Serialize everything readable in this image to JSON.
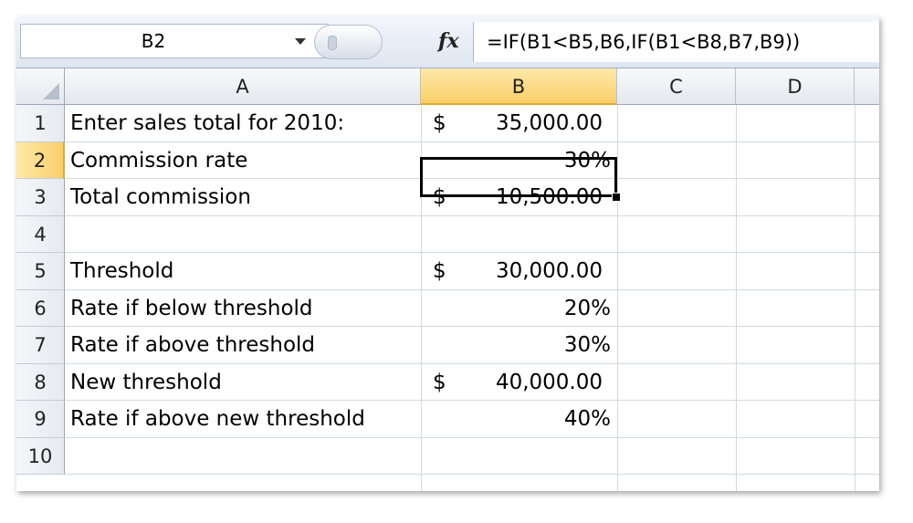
{
  "formula_bar": {
    "name_box": "B2",
    "fx_label": "fx",
    "formula": "=IF(B1<B5,B6,IF(B1<B8,B7,B9))"
  },
  "columns": [
    "A",
    "B",
    "C",
    "D"
  ],
  "active_cell": {
    "column": "B",
    "row": 2
  },
  "rows": [
    {
      "num": "1",
      "a": "Enter sales total for 2010:",
      "b_currency": "$",
      "b_value": "35,000.00"
    },
    {
      "num": "2",
      "a": "Commission rate",
      "b_currency": "",
      "b_value": "30%"
    },
    {
      "num": "3",
      "a": "Total commission",
      "b_currency": "$",
      "b_value": "10,500.00"
    },
    {
      "num": "4",
      "a": "",
      "b_currency": "",
      "b_value": ""
    },
    {
      "num": "5",
      "a": "Threshold",
      "b_currency": "$",
      "b_value": "30,000.00"
    },
    {
      "num": "6",
      "a": "Rate if below threshold",
      "b_currency": "",
      "b_value": "20%"
    },
    {
      "num": "7",
      "a": "Rate if above threshold",
      "b_currency": "",
      "b_value": "30%"
    },
    {
      "num": "8",
      "a": "New threshold",
      "b_currency": "$",
      "b_value": "40,000.00"
    },
    {
      "num": "9",
      "a": "Rate if above new threshold",
      "b_currency": "",
      "b_value": "40%"
    },
    {
      "num": "10",
      "a": "",
      "b_currency": "",
      "b_value": ""
    }
  ],
  "colors": {
    "header_highlight": "#f9cf6a",
    "grid_line": "#d4d8de"
  }
}
